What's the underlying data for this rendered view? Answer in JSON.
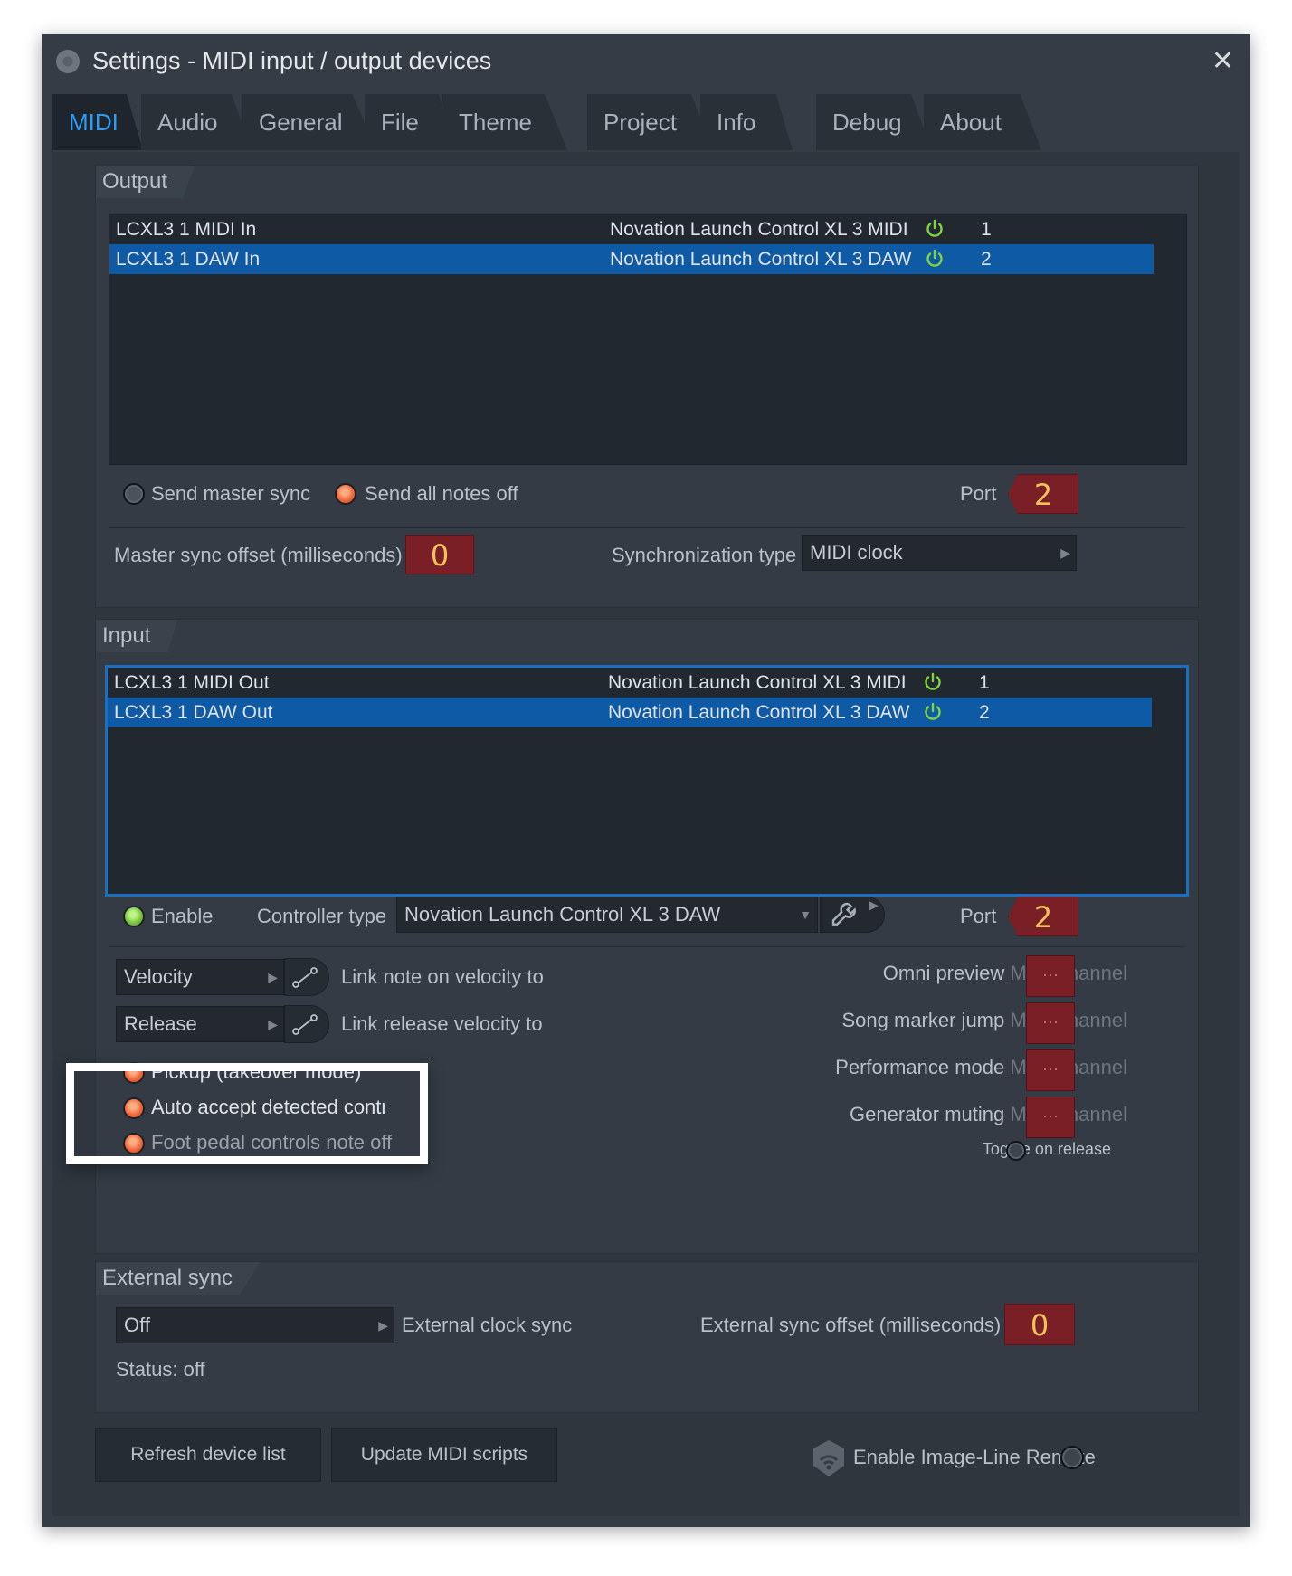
{
  "window": {
    "title": "Settings - MIDI input / output devices"
  },
  "tabs": [
    {
      "label": "MIDI"
    },
    {
      "label": "Audio"
    },
    {
      "label": "General"
    },
    {
      "label": "File"
    },
    {
      "label": "Theme"
    },
    {
      "label": "Project"
    },
    {
      "label": "Info"
    },
    {
      "label": "Debug"
    },
    {
      "label": "About"
    }
  ],
  "output": {
    "header": "Output",
    "rows": [
      {
        "name": "LCXL3 1 MIDI In",
        "device": "Novation Launch Control XL 3 MIDI",
        "port": "1"
      },
      {
        "name": "LCXL3 1 DAW In",
        "device": "Novation Launch Control XL 3 DAW",
        "port": "2"
      }
    ],
    "send_master_sync": "Send master sync",
    "send_all_notes_off": "Send all notes off",
    "port_label": "Port",
    "port_value": "2",
    "master_sync_offset_label": "Master sync offset (milliseconds)",
    "master_sync_offset_value": "0",
    "sync_type_label": "Synchronization type",
    "sync_type_value": "MIDI clock"
  },
  "input": {
    "header": "Input",
    "rows": [
      {
        "name": "LCXL3 1 MIDI Out",
        "device": "Novation Launch Control XL 3 MIDI",
        "port": "1"
      },
      {
        "name": "LCXL3 1 DAW Out",
        "device": "Novation Launch Control XL 3 DAW",
        "port": "2"
      }
    ],
    "enable_label": "Enable",
    "controller_type_label": "Controller type",
    "controller_type_value": "Novation Launch Control XL 3 DAW",
    "port_label": "Port",
    "port_value": "2",
    "velocity_dd": "Velocity",
    "link_note_on": "Link note on velocity to",
    "release_dd": "Release",
    "link_release": "Link release velocity to",
    "pickup": "Pickup (takeover mode)",
    "auto_accept": "Auto accept detected controller",
    "foot_pedal": "Foot pedal controls note off",
    "omni_preview": "Omni preview",
    "song_marker": "Song marker jump",
    "performance_mode": "Performance mode",
    "generator_muting": "Generator muting",
    "midi_channel": "MIDI channel",
    "channel_value": "···",
    "toggle_on_release": "Toggle on release"
  },
  "external_sync": {
    "header": "External sync",
    "mode_value": "Off",
    "clock_label": "External clock sync",
    "offset_label": "External sync offset (milliseconds)",
    "offset_value": "0",
    "status": "Status: off"
  },
  "footer": {
    "refresh": "Refresh device list",
    "update": "Update MIDI scripts",
    "remote": "Enable Image-Line Remote"
  },
  "colors": {
    "accent": "#2f9cf5",
    "selection": "#0f5aa4",
    "power": "#7ed63c",
    "number_bg": "#7a1f26",
    "number_fg": "#f2c15a"
  }
}
